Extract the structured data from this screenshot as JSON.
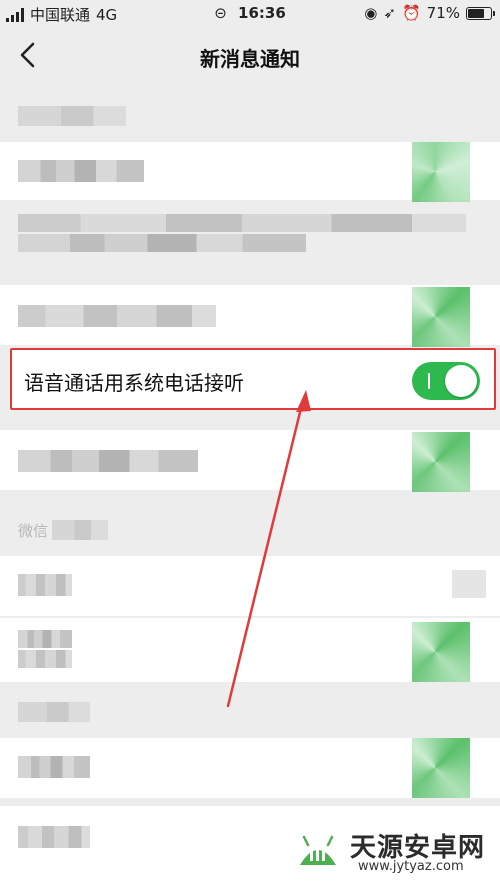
{
  "status_bar": {
    "carrier": "中国联通",
    "network": "4G",
    "time": "16:36",
    "battery": "71%",
    "battery_level": 0.71
  },
  "nav": {
    "title": "新消息通知",
    "back_icon": "chevron-left-icon"
  },
  "highlighted_setting": {
    "label": "语音通话用系统电话接听",
    "enabled": true
  },
  "section_head_partial": "微信",
  "colors": {
    "toggle_on": "#2db94d",
    "highlight_border": "#e13a3a",
    "arrow": "#e13a3a",
    "page_bg": "#ededed"
  },
  "watermark": {
    "name": "天源安卓网",
    "url": "www.jytyaz.com",
    "logo_icon": "android-logo-icon"
  }
}
